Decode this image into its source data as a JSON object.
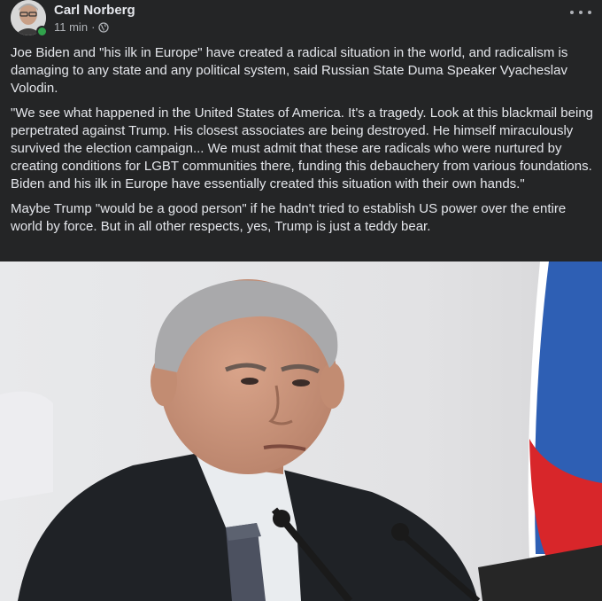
{
  "post": {
    "author": "Carl Norberg",
    "time": "11 min",
    "separator": "·",
    "privacy_icon": "globe-icon",
    "more_icon": "more-options-icon",
    "paragraphs": [
      "Joe Biden and \"his ilk in Europe\" have created a radical situation in the world, and radicalism is damaging to any state and any political system, said Russian State Duma Speaker Vyacheslav Volodin.",
      "\"We see what happened in the United States of America. It's a tragedy. Look at this blackmail being perpetrated against Trump. His closest associates are being destroyed. He himself miraculously survived the election campaign... We must admit that these are radicals who were nurtured by creating conditions for LGBT communities there, funding this debauchery from various foundations. Biden and his ilk in Europe have essentially created this situation with their own hands.\"",
      "Maybe Trump \"would be a good person\" if he hadn't tried to establish US power over the entire world by force. But in all other respects, yes, Trump is just a teddy bear."
    ]
  },
  "colors": {
    "background": "#242526",
    "text": "#e4e6eb",
    "secondary_text": "#b0b3b8",
    "online": "#31a24c"
  }
}
